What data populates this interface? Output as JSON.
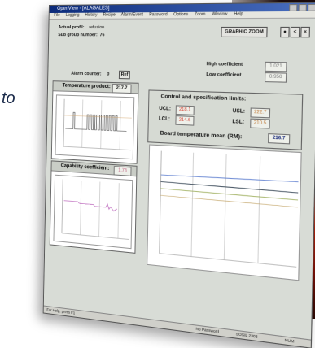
{
  "tagline": "to",
  "window": {
    "title": "OpenView - [ALAGALES]",
    "menu": [
      "File",
      "Logging",
      "History",
      "Recipe",
      "Alarm/Event",
      "Password",
      "Options",
      "Zoom",
      "Window",
      "Help"
    ]
  },
  "header": {
    "actual_profil_label": "Actual profil:",
    "actual_profil_value": "refusion",
    "sub_group_label": "Sub group number:",
    "sub_group_value": "76",
    "graphic_zoom": "GRAPHIC ZOOM"
  },
  "alarm": {
    "label": "Alarm counter:",
    "value": "0",
    "ref_button": "Ref"
  },
  "coefficients": {
    "high_label": "High coefficient",
    "high_value": "1.021",
    "low_label": "Low coefficient",
    "low_value": "0.950"
  },
  "temperature": {
    "title": "Temperature product:",
    "value": "217.7"
  },
  "capability": {
    "title": "Capability coefficient:",
    "value": "1.73"
  },
  "limits": {
    "title": "Control and specification limits:",
    "ucl_label": "UCL:",
    "ucl_value": "218.1",
    "lcl_label": "LCL:",
    "lcl_value": "214.6",
    "usl_label": "USL:",
    "usl_value": "222.7",
    "lsl_label": "LSL:",
    "lsl_value": "210.5"
  },
  "board_temp": {
    "title": "Board temperature mean (RM):",
    "value": "216.7"
  },
  "status": {
    "left": "For Help, press F1",
    "right1": "No Password",
    "right2": "SOSIL 2303",
    "right3": "NUM"
  },
  "colors": {
    "accent_title": "#0b2a7a",
    "red_value": "#d23a2a",
    "limit_orange": "#c07a3a"
  }
}
